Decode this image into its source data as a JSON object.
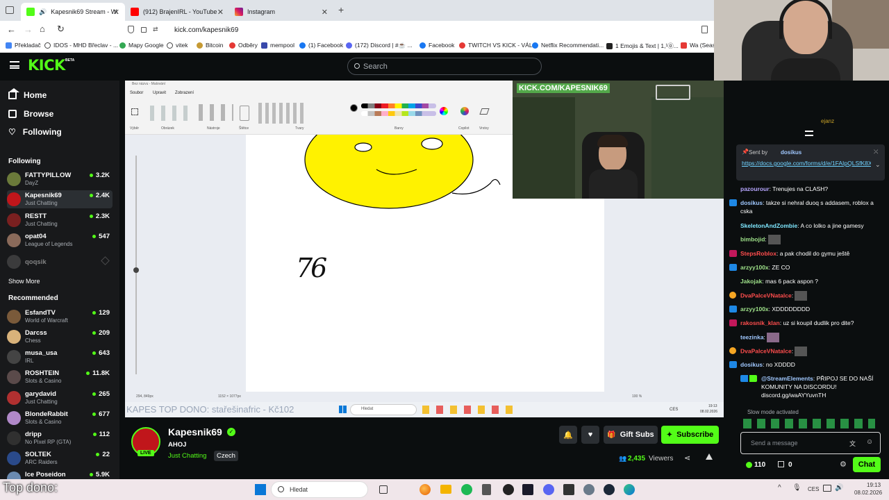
{
  "browser": {
    "tabs": [
      {
        "label": "Kapesnik69 Stream - Watch",
        "active": true
      },
      {
        "label": "(912) BrajenIRL - YouTube",
        "active": false
      },
      {
        "label": "Instagram",
        "active": false
      }
    ],
    "url": "kick.com/kapesnik69",
    "bookmarks": [
      "Překladač",
      "IDOS - MHD Břeclav - ...",
      "Mapy Google",
      "vitek",
      "Bitcoin",
      "Odběry",
      "mempool",
      "(1) Facebook",
      "(172) Discord | #☕ ...",
      "Facebook",
      "TWITCH VS KICK - VÁL...",
      "Netflix Recommendati...",
      "1 Emojis & Text | 1,¹⓪...",
      "Wa (Seaso"
    ]
  },
  "header": {
    "logo": "KICK",
    "logo_badge": "BETA",
    "search_placeholder": "Search"
  },
  "sidebar": {
    "nav": [
      {
        "label": "Home",
        "icon": "home-icon"
      },
      {
        "label": "Browse",
        "icon": "browse-icon"
      },
      {
        "label": "Following",
        "icon": "heart-icon"
      }
    ],
    "following_title": "Following",
    "following": [
      {
        "name": "FATTYPILLOW",
        "category": "DayZ",
        "viewers": "3.2K",
        "color": "#6b7a3a"
      },
      {
        "name": "Kapesnik69",
        "category": "Just Chatting",
        "viewers": "2.4K",
        "color": "#c0161b"
      },
      {
        "name": "RESTT",
        "category": "Just Chatting",
        "viewers": "2.3K",
        "color": "#7a2020"
      },
      {
        "name": "opat04",
        "category": "League of Legends",
        "viewers": "547",
        "color": "#8a6a5a"
      },
      {
        "name": "qoqsik",
        "category": "",
        "viewers": "",
        "color": "#666666"
      }
    ],
    "show_more": "Show More",
    "recommended_title": "Recommended",
    "recommended": [
      {
        "name": "EsfandTV",
        "category": "World of Warcraft",
        "viewers": "129",
        "color": "#7a5a3a"
      },
      {
        "name": "Darcss",
        "category": "Chess",
        "viewers": "209",
        "color": "#d9b27a"
      },
      {
        "name": "musa_usa",
        "category": "IRL",
        "viewers": "643",
        "color": "#444444"
      },
      {
        "name": "ROSHTEIN",
        "category": "Slots & Casino",
        "viewers": "11.8K",
        "color": "#5a4a4a"
      },
      {
        "name": "garydavid",
        "category": "Just Chatting",
        "viewers": "265",
        "color": "#b03030"
      },
      {
        "name": "BlondeRabbit",
        "category": "Slots & Casino",
        "viewers": "677",
        "color": "#b088c8"
      },
      {
        "name": "dripp",
        "category": "No Pixel RP (GTA)",
        "viewers": "112",
        "color": "#303030"
      },
      {
        "name": "SOLTEK",
        "category": "ARC Raiders",
        "viewers": "22",
        "color": "#2a4a8a"
      },
      {
        "name": "Ice Poseidon",
        "category": "",
        "viewers": "5.9K",
        "color": "#6a8ab0"
      }
    ]
  },
  "stream_overlay": {
    "paint_menu": [
      "Soubor",
      "Upravit",
      "Zobrazení"
    ],
    "paint_groups": [
      "Výběr",
      "Obrázek",
      "Nástroje",
      "Štětce",
      "Tvary",
      "Barvy",
      "Copilot",
      "Vrstvy"
    ],
    "paint_title": "Bez názvu - Malování",
    "drawn_number": "76",
    "webcam_banner": "KICK.COM/KAPESNIK69",
    "status_left": "294, 849px",
    "status_size": "1152 × 1077px",
    "zoom": "100 %",
    "donation_ticker": "KAPES TOP DONO: stařešinafric - Kč102",
    "inner_search": "Hledat",
    "inner_lang": "CES",
    "inner_time": "19:13",
    "inner_date": "08.02.2026"
  },
  "channel": {
    "name": "Kapesnik69",
    "live_badge": "LIVE",
    "title": "AHOJ",
    "category": "Just Chatting",
    "tag": "Czech",
    "viewers": "2,435",
    "viewers_label": "Viewers",
    "gift_subs": "Gift Subs",
    "subscribe": "Subscribe"
  },
  "chat": {
    "top_user": "ejanz",
    "pinned": {
      "label": "Sent by",
      "user": "dosikus",
      "link": "https://docs.google.com/forms/d/e/1FAIpQLSfK8XZiW8O4US9IHYBRMI..."
    },
    "messages": [
      {
        "user": "pazourour",
        "text": "Trenujes na CLASH?",
        "color": "#b7a6ff"
      },
      {
        "user": "dosikus",
        "text": "takze si nehral duoq s addasem, roblox a cska",
        "color": "#a0c8ff"
      },
      {
        "user": "SkeletonAndZombie",
        "text": "A co lolko a jine gamesy",
        "color": "#7fe7ff"
      },
      {
        "user": "bimbojid",
        "text": "",
        "color": "#9fe28a"
      },
      {
        "user": "StepsRoblox",
        "text": "a pak chodil do gymu ještě",
        "color": "#ff4d4d"
      },
      {
        "user": "arzyy100x",
        "text": "ZE CO",
        "color": "#9fe28a"
      },
      {
        "user": "Jakojak",
        "text": "mas 6 pack aspon ?",
        "color": "#9fe28a"
      },
      {
        "user": "DvaPalceVNatalce",
        "text": "",
        "color": "#ff4d4d"
      },
      {
        "user": "arzyy100x",
        "text": "XDDDDDDDD",
        "color": "#9fe28a"
      },
      {
        "user": "rakosnik_klan",
        "text": "uz si koupil dudlik pro dite?",
        "color": "#ff4d4d"
      },
      {
        "user": "teezinka",
        "text": "",
        "color": "#a0c8ff"
      },
      {
        "user": "DvaPalceVNatalce",
        "text": "",
        "color": "#ff4d4d"
      },
      {
        "user": "dosikus",
        "text": "no XDDDD",
        "color": "#a0c8ff"
      },
      {
        "user": "@StreamElements",
        "text": "PŘIPOJ SE DO NAŠÍ KOMUNITY NA DISCORDU! discord.gg/waAYYuvnTH",
        "color": "#a0c8ff"
      }
    ],
    "slow_mode": "Slow mode activated",
    "input_placeholder": "Send a message",
    "points": "110",
    "gifts": "0",
    "chat_button": "Chat"
  },
  "os_taskbar": {
    "search": "Hledat",
    "lang": "CES",
    "time": "19:13",
    "date": "08.02.2026"
  },
  "outer_overlay": {
    "top_dono": "Top dono:"
  },
  "colors": {
    "kick_green": "#53fc18",
    "bg": "#0b0e0f",
    "sidebar": "#18191b"
  }
}
